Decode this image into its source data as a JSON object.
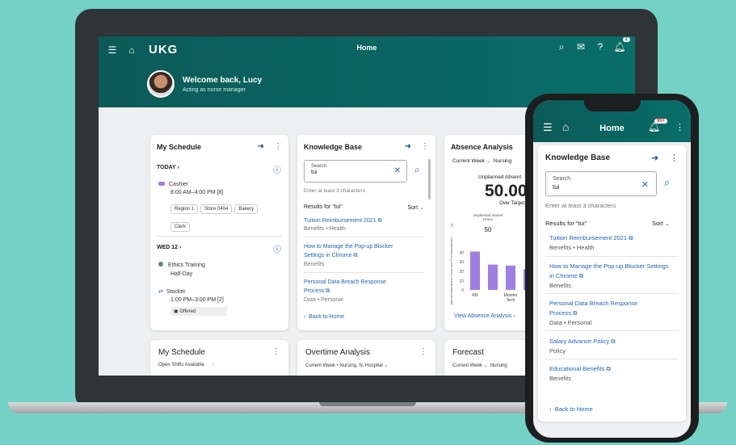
{
  "app": {
    "logo": "UKG",
    "page_title": "Home",
    "notif_count": "2"
  },
  "user": {
    "welcome": "Welcome back, Lucy",
    "role": "Acting as nurse manager"
  },
  "schedule": {
    "title": "My Schedule",
    "today_label": "TODAY",
    "shift1": {
      "name": "Cashier",
      "time": "8:00 AM–4:00 PM [8]",
      "tags": [
        "Region 1",
        "Store 0404",
        "Bakery",
        "Clerk"
      ]
    },
    "wed_label": "WED 12",
    "shift2": {
      "name": "Ethics Training",
      "time": "Half-Day"
    },
    "shift3": {
      "name": "Stocker",
      "time": "1:00 PM–3:00 PM [2]",
      "status": "Offered"
    }
  },
  "kb": {
    "title": "Knowledge Base",
    "search_label": "Search",
    "search_value": "tui",
    "hint": "Enter at least 3 characters",
    "results_label": "Results for \"tui\"",
    "sort_label": "Sort",
    "results": [
      {
        "title": "Tuition Reimbursement 2021",
        "meta": "Benefits • Health"
      },
      {
        "title": "How to Manage the Pop-up Blocker Settings in Chrome",
        "meta": "Benefits"
      },
      {
        "title": "Personal Data Breach Response Process",
        "meta": "Data • Personal"
      }
    ],
    "back": "Back to Home"
  },
  "absence": {
    "title": "Absence Analysis",
    "filter": "Current Week",
    "filter2": "Nursing",
    "metric_label": "Unplanned Absent",
    "metric_value": "50.00",
    "target_label": "Over Target",
    "mini_label": "Unplanned Absent Hours",
    "mini_value": "50",
    "y_axis": "Unplanned Absenteeism Hours as a % of Absenteeism Hours",
    "cat_labels": [
      "RN",
      "Monitor Tech"
    ],
    "link": "View Absence Analysis"
  },
  "chart_data": {
    "type": "bar",
    "categories": [
      "RN",
      "",
      "Monitor Tech",
      ""
    ],
    "values": [
      41,
      27,
      26,
      22
    ],
    "ylim": [
      0,
      50
    ],
    "yticks": [
      0,
      10,
      20,
      30,
      40
    ],
    "ylabel": "Unplanned Absenteeism Hours as a % of Absenteeism Hours",
    "color": "#9e7fe0"
  },
  "bottom": {
    "schedule_title": "My Schedule",
    "schedule_sub": "Open Shifts Available",
    "overtime_title": "Overtime Analysis",
    "overtime_sub": "Current Week • Nursing, N. Hospital",
    "forecast_title": "Forecast",
    "forecast_sub": "Current Week",
    "forecast_sub2": "Nursing"
  },
  "phone": {
    "title": "Home",
    "badge": "99+",
    "kb_title": "Knowledge Base",
    "search_label": "Search",
    "search_value": "tui",
    "hint": "Enter at least 3 characters",
    "results_label": "Results for \"tui\"",
    "sort_label": "Sort",
    "results": [
      {
        "title": "Tuition Reimbursement 2021",
        "meta": "Benefits • Health"
      },
      {
        "title": "How to Manage the Pop-up Blocker Settings in Chrome",
        "meta": "Benefits"
      },
      {
        "title": "Personal Data Breach Response Process",
        "meta": "Data • Personal"
      },
      {
        "title": "Salary Advance Policy",
        "meta": "Policy"
      },
      {
        "title": "Educational Benefits",
        "meta": "Benefits"
      }
    ],
    "back": "Back to Home"
  },
  "colors": {
    "brand": "#0a6461",
    "link": "#2064b5",
    "background": "#74d1c6"
  }
}
